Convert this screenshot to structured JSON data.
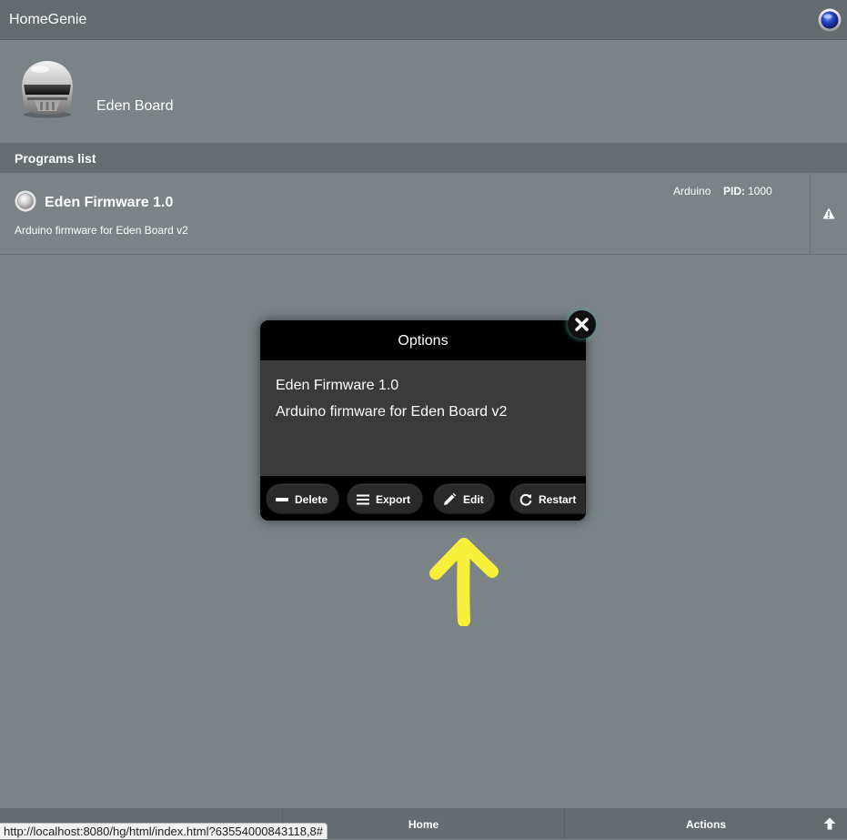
{
  "app": {
    "title": "HomeGenie",
    "status_icon": "blue-orb-icon"
  },
  "group": {
    "name": "Eden Board",
    "icon": "robot-helmet-icon"
  },
  "programs_list": {
    "header": "Programs list",
    "items": [
      {
        "name": "Eden Firmware 1.0",
        "description": "Arduino firmware for Eden Board v2",
        "type": "Arduino",
        "pid_label": "PID:",
        "pid": "1000",
        "status_icon": "grey-orb-icon",
        "action_icon": "warning-icon"
      }
    ]
  },
  "dialog": {
    "title": "Options",
    "line1": "Eden Firmware 1.0",
    "line2": "Arduino firmware for Eden Board v2",
    "buttons": {
      "delete": "Delete",
      "export": "Export",
      "edit": "Edit",
      "restart": "Restart"
    },
    "close_icon": "close-icon"
  },
  "annotation": {
    "arrow_color": "#f7f03a",
    "icon": "arrow-up-icon"
  },
  "footer": {
    "home": "Home",
    "actions": "Actions",
    "up_icon": "arrow-up-icon"
  },
  "status_url": "http://localhost:8080/hg/html/index.html?63554000843118,8#",
  "colors": {
    "background": "#7b8387",
    "header": "#636b6f",
    "dialog_head": "#000000",
    "dialog_body": "#3b3b3b"
  }
}
